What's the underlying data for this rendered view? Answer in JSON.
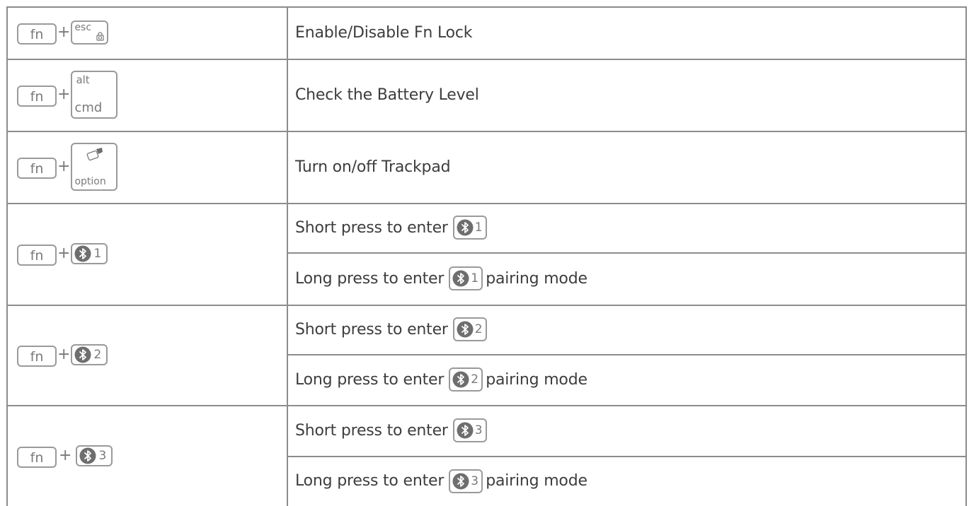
{
  "rows": [
    {
      "keys": {
        "fn": "fn",
        "esc": "esc"
      },
      "action": "Enable/Disable Fn Lock"
    },
    {
      "keys": {
        "fn": "fn",
        "top": "alt",
        "bottom": "cmd"
      },
      "action": "Check the Battery Level"
    },
    {
      "keys": {
        "fn": "fn",
        "bottom": "option",
        "icon": "trackpad-icon"
      },
      "action": "Turn on/off Trackpad"
    },
    {
      "keys": {
        "fn": "fn",
        "channel": "1",
        "icon": "bluetooth-icon"
      },
      "short_prefix": "Short press to enter",
      "long_prefix": "Long press to enter",
      "long_suffix": "pairing mode"
    },
    {
      "keys": {
        "fn": "fn",
        "channel": "2",
        "icon": "bluetooth-icon"
      },
      "short_prefix": "Short press to enter",
      "long_prefix": "Long press to enter",
      "long_suffix": "pairing mode"
    },
    {
      "keys": {
        "fn": "fn",
        "channel": "3",
        "icon": "bluetooth-icon"
      },
      "short_prefix": "Short press to enter",
      "long_prefix": "Long press to enter",
      "long_suffix": "pairing mode"
    }
  ],
  "plus": "+",
  "colors": {
    "border": "#8c8c8c",
    "text": "#3d3d3d",
    "key": "#9a9a9a",
    "key_text": "#7a7a7a"
  }
}
